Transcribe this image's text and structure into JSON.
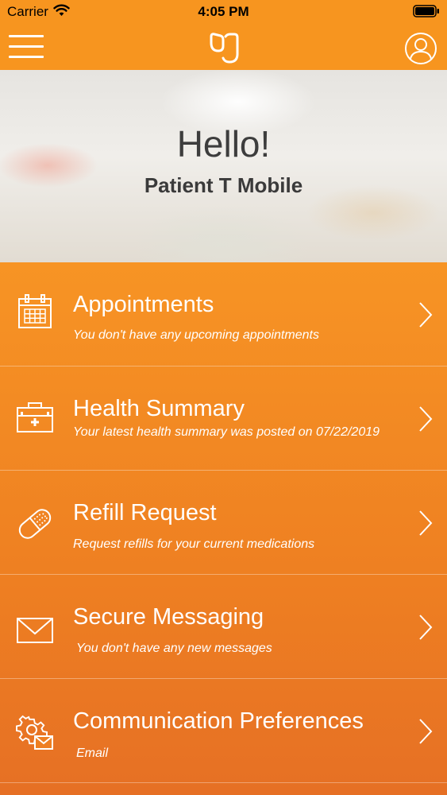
{
  "status_bar": {
    "carrier": "Carrier",
    "time": "4:05 PM"
  },
  "header": {
    "icons": [
      "menu-icon",
      "logo-icon",
      "profile-icon"
    ]
  },
  "hero": {
    "greeting": "Hello!",
    "name": "Patient T Mobile"
  },
  "menu": {
    "items": [
      {
        "icon": "calendar-icon",
        "title": "Appointments",
        "subtitle": "You don't have any upcoming appointments"
      },
      {
        "icon": "medical-kit-icon",
        "title": "Health Summary",
        "subtitle": "Your latest health summary was posted on 07/22/2019"
      },
      {
        "icon": "pill-icon",
        "title": "Refill Request",
        "subtitle": "Request refills for your current medications"
      },
      {
        "icon": "envelope-icon",
        "title": "Secure Messaging",
        "subtitle": "You don't have any new messages"
      },
      {
        "icon": "gear-envelope-icon",
        "title": "Communication Preferences",
        "subtitle": "Email"
      }
    ]
  },
  "colors": {
    "accent": "#f7951f",
    "text_light": "#ffffff",
    "hero_text": "#3d3d3d"
  }
}
